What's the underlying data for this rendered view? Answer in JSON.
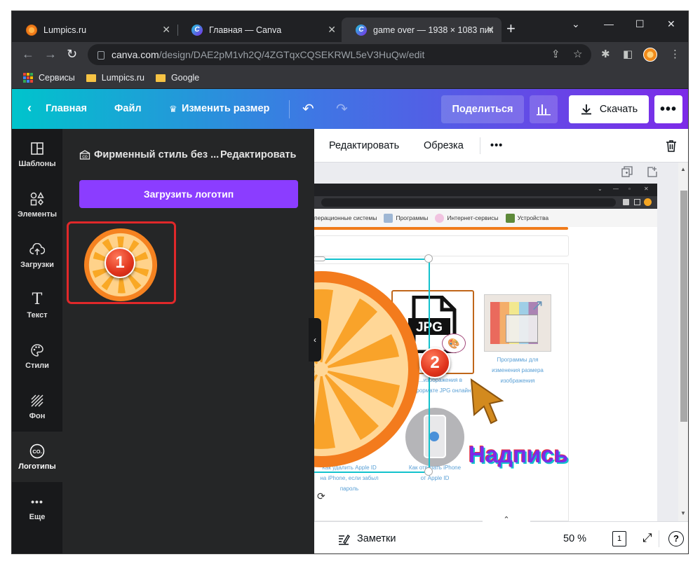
{
  "browser": {
    "tabs": [
      {
        "title": "Lumpics.ru",
        "close": "✕"
      },
      {
        "title": "Главная — Canva",
        "close": "✕"
      },
      {
        "title": "game over — 1938 × 1083 пик",
        "close": "✕"
      }
    ],
    "new_tab": "+",
    "window_controls": {
      "chevron": "⌄",
      "minimize": "—",
      "maximize": "☐",
      "close": "✕"
    },
    "url_host": "canva.com",
    "url_path": "/design/DAE2pM1vh2Q/4ZGTqxCQSEKRWL5eV3HuQw/edit",
    "bookmarks": [
      {
        "label": "Сервисы",
        "icon": "apps-grid-icon"
      },
      {
        "label": "Lumpics.ru",
        "icon": "folder-icon"
      },
      {
        "label": "Google",
        "icon": "folder-icon"
      }
    ]
  },
  "canva_header": {
    "home": "Главная",
    "file": "Файл",
    "resize": "Изменить размер",
    "share": "Поделиться",
    "download": "Скачать",
    "more": "•••"
  },
  "rail": [
    {
      "label": "Шаблоны",
      "icon": "templates-icon"
    },
    {
      "label": "Элементы",
      "icon": "elements-icon"
    },
    {
      "label": "Загрузки",
      "icon": "upload-cloud-icon"
    },
    {
      "label": "Текст",
      "icon": "text-icon"
    },
    {
      "label": "Стили",
      "icon": "palette-icon"
    },
    {
      "label": "Фон",
      "icon": "background-icon"
    },
    {
      "label": "Логотипы",
      "icon": "logo-icon",
      "active": true
    },
    {
      "label": "Еще",
      "icon": "more-dots-icon"
    }
  ],
  "panel": {
    "title": "Фирменный стиль без ...",
    "edit": "Редактировать",
    "upload_logo": "Загрузить логотип",
    "marker_1": "1"
  },
  "editor": {
    "ctx_edit": "Редактировать",
    "ctx_crop": "Обрезка",
    "ctx_more": "•••",
    "notes": "Заметки",
    "zoom": "50 %",
    "page_count": "1",
    "help": "?"
  },
  "inner_screenshot": {
    "nav": [
      "перационные системы",
      "Программы",
      "Интернет-сервисы",
      "Устройства"
    ],
    "caption_left": "Как удалить Apple ID\nна iPhone, если забыл\nпароль",
    "caption_mid": "Как отвязать iPhone\nот Apple ID",
    "caption_jpg": "...е\n...изображения в\n...формате JPG онлайн",
    "caption_resize": "Программы для\nизменения размера\nизображения",
    "jpg_label": "JPG",
    "marker_2": "2",
    "text_element": "Надпись"
  },
  "colors": {
    "accent_purple": "#8b3dff",
    "highlight_red": "#e0282a",
    "orange": "#f07b1a",
    "selection_cyan": "#13c2cd"
  }
}
